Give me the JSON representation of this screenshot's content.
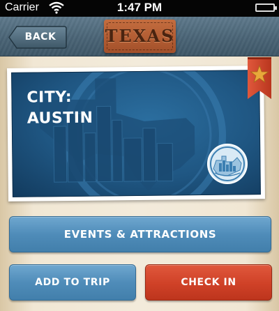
{
  "status_bar": {
    "carrier": "Carrier",
    "time": "1:47 PM"
  },
  "nav": {
    "back_label": "BACK",
    "logo_text": "TEXAS"
  },
  "city_card": {
    "city_prefix": "CITY:",
    "city_name": "AUSTIN"
  },
  "actions": {
    "events_label": "EVENTS & ATTRACTIONS",
    "add_trip_label": "ADD TO TRIP",
    "checkin_label": "CHECK IN"
  },
  "colors": {
    "nav_bar": "#4a6476",
    "card_blue": "#1f5682",
    "button_blue": "#4f8cb9",
    "button_red": "#cf4127",
    "ribbon_red": "#d8462a",
    "star_gold": "#e8a83a",
    "leather": "#b35c33"
  },
  "icons": {
    "wifi": "wifi-icon",
    "battery": "battery-icon",
    "bookmark": "bookmark-ribbon-icon",
    "star": "star-icon",
    "stamp": "city-stamp-icon"
  }
}
